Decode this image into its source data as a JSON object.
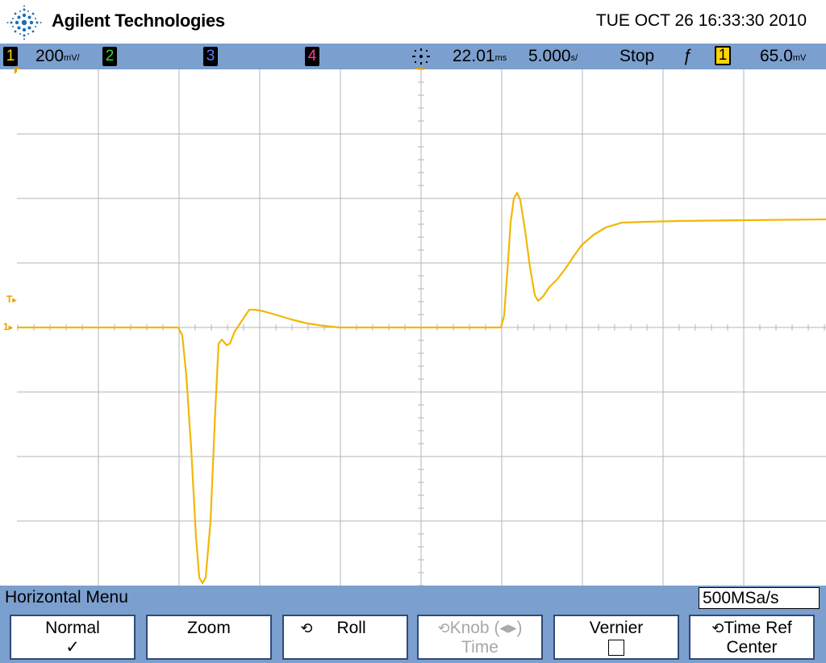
{
  "header": {
    "brand": "Agilent Technologies",
    "datetime": "TUE OCT 26 16:33:30 2010"
  },
  "status": {
    "ch1_num": "1",
    "ch1_scale_value": "200",
    "ch1_scale_unit": "mV/",
    "ch2_num": "2",
    "ch3_num": "3",
    "ch4_num": "4",
    "time_delay_value": "22.01",
    "time_delay_unit": "ms",
    "time_scale_value": "5.000",
    "time_scale_unit": "s/",
    "run_state": "Stop",
    "trigger_slope_symbol": "ƒ",
    "trigger_source": "1",
    "trigger_level_value": "65.0",
    "trigger_level_unit": "mV"
  },
  "colors": {
    "ch1": "#ffd400",
    "ch2": "#2fdc2f",
    "ch3": "#3b5bff",
    "ch4": "#ff3a9a",
    "trace": "#f2b705",
    "statusbar": "#7b9fce",
    "grid": "#b4b4b4"
  },
  "markers": {
    "trigger_marker": "T",
    "ground_marker": "1"
  },
  "menu": {
    "title": "Horizontal Menu",
    "sample_rate": "500MSa/s",
    "softkeys": [
      {
        "line1": "Normal",
        "line2": "✓",
        "enabled": true,
        "icon": ""
      },
      {
        "line1": "Zoom",
        "line2": "",
        "enabled": true,
        "icon": ""
      },
      {
        "line1": "Roll",
        "line2": "",
        "enabled": true,
        "icon": "knob-icon"
      },
      {
        "line1": "Knob (◂▸)",
        "line2": "Time",
        "enabled": false,
        "icon": "knob-icon"
      },
      {
        "line1": "Vernier",
        "line2": "",
        "enabled": true,
        "icon": "checkbox"
      },
      {
        "line1": "Time Ref",
        "line2": "Center",
        "enabled": true,
        "icon": "knob-icon"
      }
    ]
  }
}
